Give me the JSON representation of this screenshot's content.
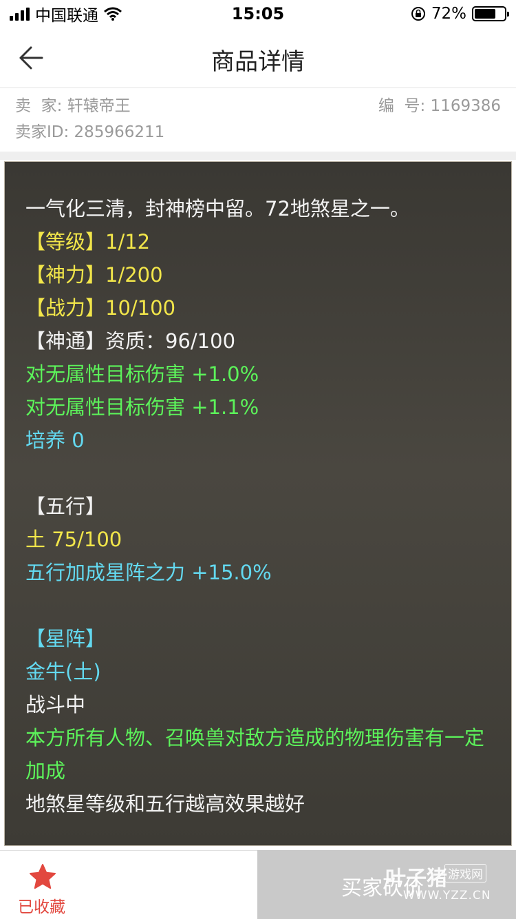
{
  "status_bar": {
    "carrier": "中国联通",
    "time": "15:05",
    "battery_percent_text": "72%",
    "battery_level": 0.72
  },
  "nav": {
    "title": "商品详情"
  },
  "seller": {
    "name_text": "卖  家: 轩辕帝王",
    "serial_text": "编  号: 1169386",
    "id_text": "卖家ID: 285966211"
  },
  "description": {
    "lines": [
      "一气化三清，封神榜中留。72地煞星之一。",
      "【等级】1/12",
      "【神力】1/200",
      "【战力】10/100",
      "【神通】资质：96/100",
      "对无属性目标伤害 +1.0%",
      "对无属性目标伤害 +1.1%",
      "培养 0",
      "【五行】",
      "土 75/100",
      "五行加成星阵之力 +15.0%",
      "【星阵】",
      "金牛(土)",
      "战斗中",
      "本方所有人物、召唤兽对敌方造成的物理伤害有一定加成",
      "地煞星等级和五行越高效果越好"
    ]
  },
  "bottom_bar": {
    "favorite_label": "已收藏",
    "buy_label": "买家砍价",
    "watermark_main": "叶子猪",
    "watermark_tag": "游戏网",
    "watermark_url": "WWW.YZZ.CN"
  },
  "colors": {
    "white_text": "#f3f3f3",
    "yellow_text": "#f2e64a",
    "green_text": "#5cf35a",
    "cyan_text": "#63d9f0",
    "favorite_red": "#e2483f",
    "panel_bg": "#3f3d37"
  },
  "icons": {
    "back": "arrow-left-icon",
    "favorite": "star-icon"
  }
}
